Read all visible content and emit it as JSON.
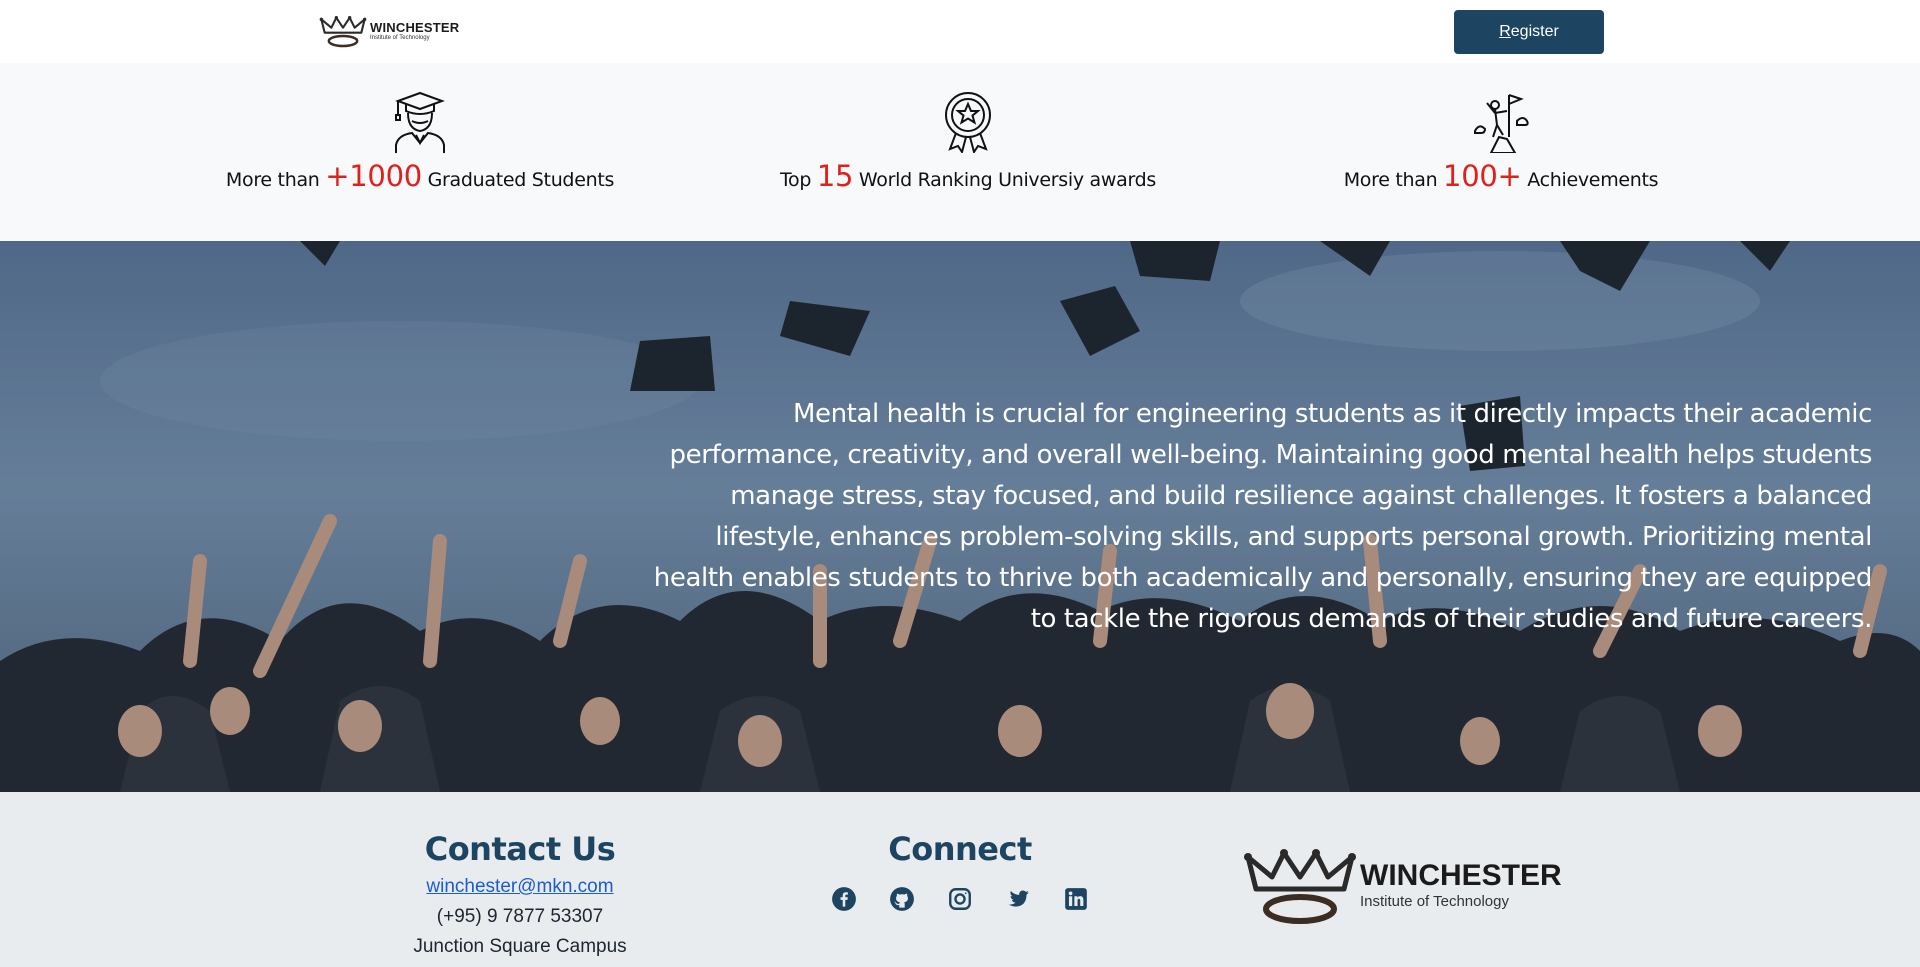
{
  "navbar": {
    "logo": {
      "name": "WINCHESTER",
      "subtitle": "Institute of Technology"
    },
    "register_label": "Register"
  },
  "stats": [
    {
      "icon": "graduate-icon",
      "prefix": "More than ",
      "number": "+1000",
      "suffix": " Graduated Students"
    },
    {
      "icon": "award-medal-icon",
      "prefix": "Top ",
      "number": "15",
      "suffix": " World Ranking Universiy awards"
    },
    {
      "icon": "achievement-icon",
      "prefix": "More than ",
      "number": "100+",
      "suffix": " Achievements"
    }
  ],
  "hero": {
    "text": "Mental health is crucial for engineering students as it directly impacts their academic performance, creativity, and overall well-being. Maintaining good mental health helps students manage stress, stay focused, and build resilience against challenges. It fosters a balanced lifestyle, enhances problem-solving skills, and supports personal growth. Prioritizing mental health enables students to thrive both academically and personally, ensuring they are equipped to tackle the rigorous demands of their studies and future careers."
  },
  "footer": {
    "contact": {
      "heading": "Contact Us",
      "email": "winchester@mkn.com",
      "phone": "(+95) 9 7877 53307",
      "campus": "Junction Square Campus"
    },
    "connect": {
      "heading": "Connect",
      "socials": [
        "facebook-icon",
        "github-icon",
        "instagram-icon",
        "twitter-icon",
        "linkedin-icon"
      ]
    },
    "logo": {
      "name": "WINCHESTER",
      "subtitle": "Institute of Technology"
    }
  },
  "colors": {
    "brand_navy": "#1d4562",
    "accent_red": "#e0201b",
    "link_blue": "#1a5cd6"
  }
}
